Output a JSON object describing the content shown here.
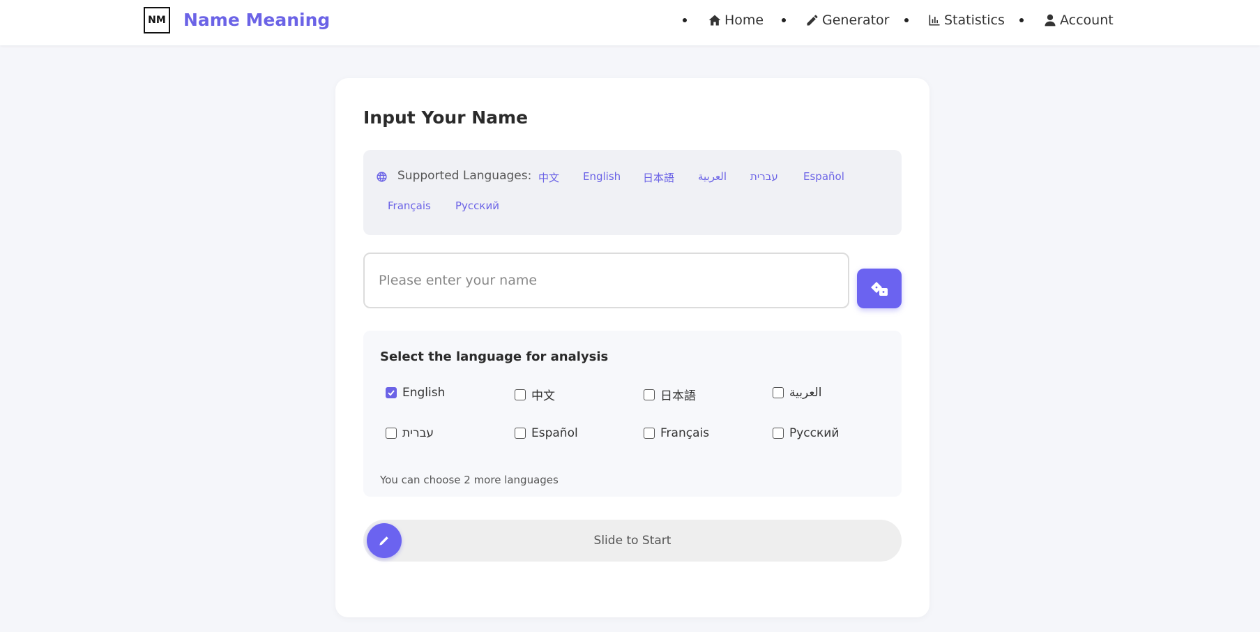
{
  "header": {
    "logo_text": "NM",
    "brand": "Name Meaning",
    "nav": [
      {
        "label": "Home",
        "icon": "home-icon"
      },
      {
        "label": "Generator",
        "icon": "pencil-icon"
      },
      {
        "label": "Statistics",
        "icon": "chart-icon"
      },
      {
        "label": "Account",
        "icon": "user-icon"
      }
    ]
  },
  "card": {
    "title": "Input Your Name",
    "supported": {
      "label": "Supported Languages:",
      "icon": "globe-icon",
      "languages": [
        "中文",
        "English",
        "日本語",
        "العربية",
        "עברית",
        "Español",
        "Français",
        "Русский"
      ]
    },
    "input": {
      "placeholder": "Please enter your name",
      "value": ""
    },
    "random_button_icon": "dice-icon",
    "selection": {
      "title": "Select the language for analysis",
      "options": [
        {
          "label": "English",
          "checked": true
        },
        {
          "label": "中文",
          "checked": false
        },
        {
          "label": "日本語",
          "checked": false
        },
        {
          "label": "العربية",
          "checked": false
        },
        {
          "label": "עברית",
          "checked": false
        },
        {
          "label": "Español",
          "checked": false
        },
        {
          "label": "Français",
          "checked": false
        },
        {
          "label": "Русский",
          "checked": false
        }
      ],
      "hint": "You can choose 2 more languages"
    },
    "slider": {
      "label": "Slide to Start",
      "icon": "pencil-icon"
    }
  },
  "colors": {
    "accent": "#6b63e6",
    "background": "#f5f6fa",
    "card": "#ffffff"
  }
}
